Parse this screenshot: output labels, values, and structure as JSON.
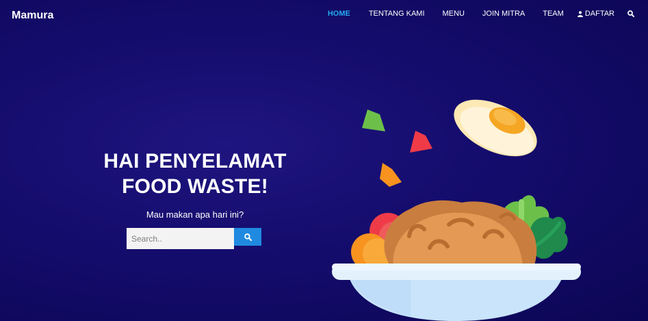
{
  "navbar": {
    "brand": "Mamura",
    "items": [
      {
        "label": "HOME",
        "active": true
      },
      {
        "label": "TENTANG KAMI"
      },
      {
        "label": "MENU"
      },
      {
        "label": "JOIN MITRA"
      },
      {
        "label": "TEAM"
      },
      {
        "label": "DAFTAR",
        "icon": "user-icon"
      }
    ],
    "search_icon": "search-icon"
  },
  "hero": {
    "title_line1": "HAI PENYELAMAT",
    "title_line2": "FOOD WASTE!",
    "subtitle": "Mau makan apa hari ini?",
    "search_placeholder": "Search..",
    "search_button_icon": "search-icon"
  },
  "illustration": {
    "icon": "fried-rice-bowl-icon"
  },
  "colors": {
    "background": "#150d6e",
    "active_link": "#22a7f0",
    "search_button": "#1f8ae0"
  }
}
